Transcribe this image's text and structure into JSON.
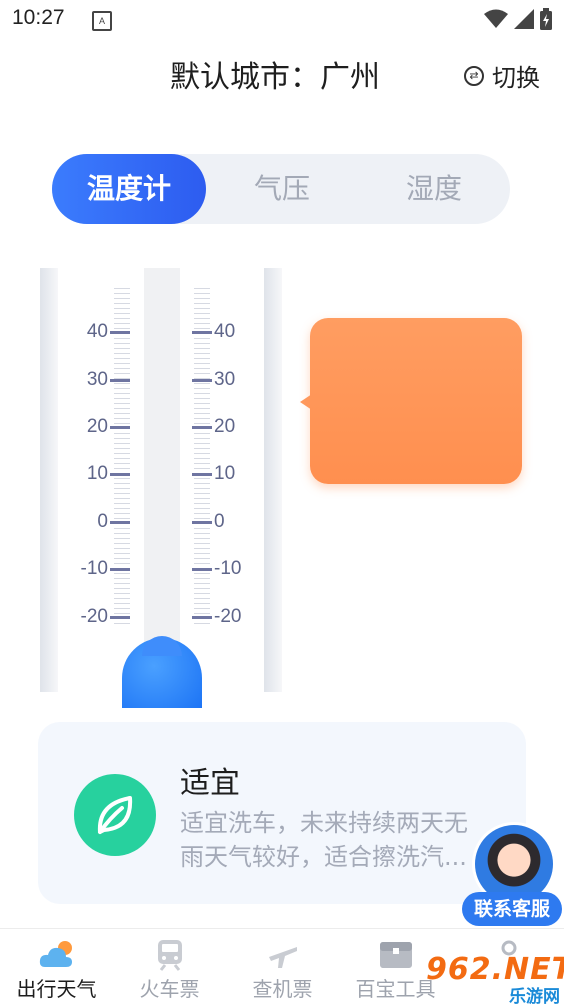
{
  "status_bar": {
    "time": "10:27",
    "notification_icon": "A"
  },
  "header": {
    "title": "默认城市：广州",
    "switch_label": "切换",
    "switch_icon": "⇄"
  },
  "tabs": [
    {
      "label": "温度计",
      "active": true
    },
    {
      "label": "气压",
      "active": false
    },
    {
      "label": "湿度",
      "active": false
    }
  ],
  "thermometer": {
    "left_scale": [
      "40",
      "30",
      "20",
      "10",
      "0",
      "-10",
      "-20"
    ],
    "right_scale": [
      "40",
      "30",
      "20",
      "10",
      "0",
      "-10",
      "-20"
    ]
  },
  "tip_card": {
    "title": "适宜",
    "description": "适宜洗车，未来持续两天无雨天气较好，适合擦洗汽..."
  },
  "customer_service": {
    "label": "联系客服"
  },
  "nav": [
    {
      "label": "出行天气",
      "icon": "weather-icon",
      "active": true
    },
    {
      "label": "火车票",
      "icon": "train-icon",
      "active": false
    },
    {
      "label": "查机票",
      "icon": "plane-icon",
      "active": false
    },
    {
      "label": "百宝工具",
      "icon": "toolbox-icon",
      "active": false
    },
    {
      "label": "",
      "icon": "profile-icon",
      "active": false
    }
  ],
  "watermark": {
    "line1": "962.NET",
    "line2": "乐游网"
  },
  "colors": {
    "accent_blue": "#2d5cf0",
    "bubble_orange": "#ff9a5e",
    "leaf_green": "#27d19e"
  }
}
